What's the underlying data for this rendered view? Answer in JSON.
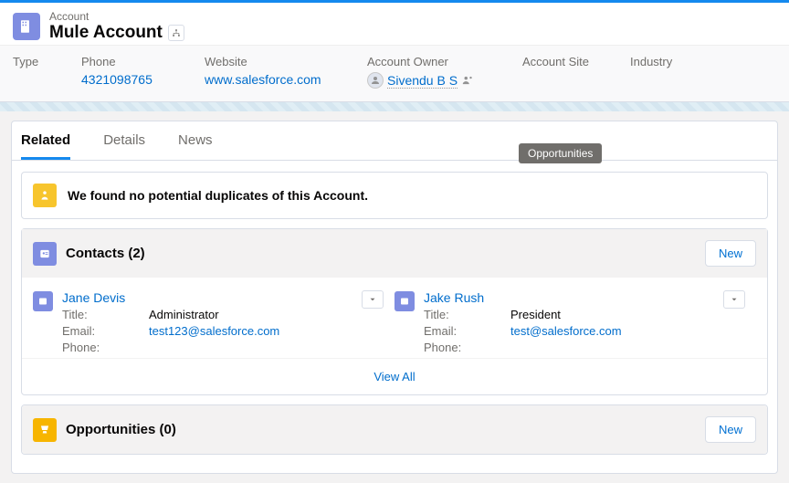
{
  "header": {
    "object_label": "Account",
    "record_name": "Mule Account"
  },
  "highlights": {
    "type_label": "Type",
    "phone_label": "Phone",
    "phone_value": "4321098765",
    "website_label": "Website",
    "website_value": "www.salesforce.com",
    "owner_label": "Account Owner",
    "owner_value": "Sivendu B S",
    "site_label": "Account Site",
    "industry_label": "Industry"
  },
  "tabs": {
    "related": "Related",
    "details": "Details",
    "news": "News"
  },
  "tooltip": "Opportunities",
  "duplicates_msg": "We found no potential duplicates of this Account.",
  "contacts": {
    "title": "Contacts (2)",
    "new_label": "New",
    "view_all": "View All",
    "items": [
      {
        "name": "Jane Devis",
        "title_label": "Title:",
        "title_value": "Administrator",
        "email_label": "Email:",
        "email_value": "test123@salesforce.com",
        "phone_label": "Phone:",
        "phone_value": ""
      },
      {
        "name": "Jake Rush",
        "title_label": "Title:",
        "title_value": "President",
        "email_label": "Email:",
        "email_value": "test@salesforce.com",
        "phone_label": "Phone:",
        "phone_value": ""
      }
    ]
  },
  "opportunities": {
    "title": "Opportunities (0)",
    "new_label": "New"
  }
}
